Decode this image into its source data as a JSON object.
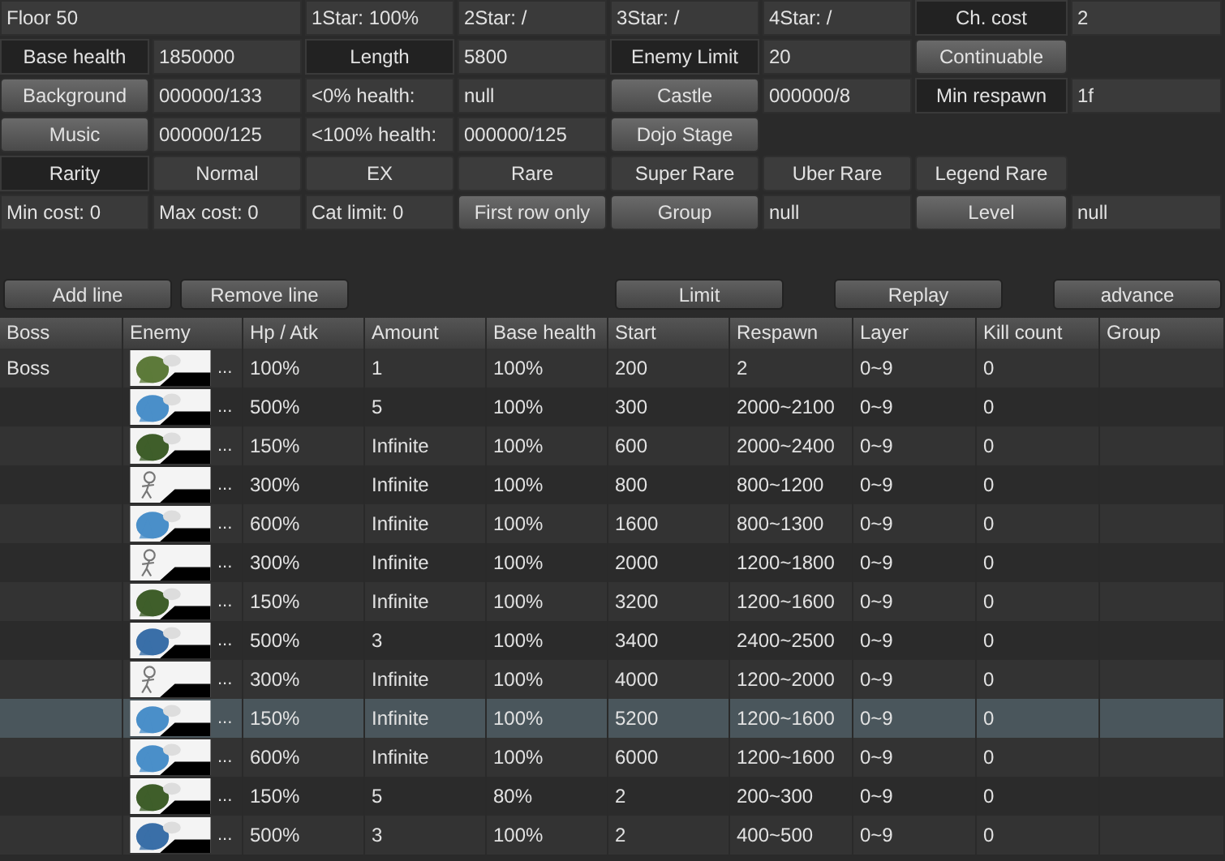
{
  "settings": [
    {
      "kind": "title",
      "text": "Floor 50"
    },
    {
      "kind": "text",
      "text": "1Star: 100%"
    },
    {
      "kind": "text",
      "text": "2Star: /"
    },
    {
      "kind": "text",
      "text": "3Star: /"
    },
    {
      "kind": "text",
      "text": "4Star: /"
    },
    {
      "kind": "label",
      "text": "Ch. cost"
    },
    {
      "kind": "text",
      "text": "2"
    },
    {
      "kind": "label",
      "text": "Base health"
    },
    {
      "kind": "text",
      "text": "1850000"
    },
    {
      "kind": "label",
      "text": "Length"
    },
    {
      "kind": "text",
      "text": "5800"
    },
    {
      "kind": "label",
      "text": "Enemy Limit"
    },
    {
      "kind": "text",
      "text": "20"
    },
    {
      "kind": "button",
      "text": "Continuable"
    },
    {
      "kind": "empty"
    },
    {
      "kind": "button",
      "text": "Background"
    },
    {
      "kind": "text",
      "text": "000000/133"
    },
    {
      "kind": "text",
      "text": "<0% health:"
    },
    {
      "kind": "text",
      "text": "null"
    },
    {
      "kind": "button",
      "text": "Castle"
    },
    {
      "kind": "text",
      "text": "000000/8"
    },
    {
      "kind": "label",
      "text": "Min respawn"
    },
    {
      "kind": "text",
      "text": "1f"
    },
    {
      "kind": "button",
      "text": "Music"
    },
    {
      "kind": "text",
      "text": "000000/125"
    },
    {
      "kind": "text",
      "text": "<100% health:"
    },
    {
      "kind": "text",
      "text": "000000/125"
    },
    {
      "kind": "button",
      "text": "Dojo Stage"
    },
    {
      "kind": "empty"
    },
    {
      "kind": "empty"
    },
    {
      "kind": "empty"
    },
    {
      "kind": "label",
      "text": "Rarity"
    },
    {
      "kind": "toggle",
      "text": "Normal"
    },
    {
      "kind": "toggle",
      "text": "EX"
    },
    {
      "kind": "toggle",
      "text": "Rare"
    },
    {
      "kind": "toggle",
      "text": "Super Rare"
    },
    {
      "kind": "toggle",
      "text": "Uber Rare"
    },
    {
      "kind": "toggle",
      "text": "Legend Rare"
    },
    {
      "kind": "empty"
    },
    {
      "kind": "text",
      "text": "Min cost: 0"
    },
    {
      "kind": "text",
      "text": "Max cost: 0"
    },
    {
      "kind": "text",
      "text": "Cat limit: 0"
    },
    {
      "kind": "button",
      "text": "First row only"
    },
    {
      "kind": "button",
      "text": "Group"
    },
    {
      "kind": "text",
      "text": "null"
    },
    {
      "kind": "button",
      "text": "Level"
    },
    {
      "kind": "text",
      "text": "null"
    }
  ],
  "actions_left": [
    "Add line",
    "Remove line"
  ],
  "actions_right": [
    "Limit",
    "Replay",
    "advance"
  ],
  "table": {
    "columns": [
      "Boss",
      "Enemy",
      "Hp / Atk",
      "Amount",
      "Base health",
      "Start",
      "Respawn",
      "Layer",
      "Kill count",
      "Group"
    ],
    "rows": [
      {
        "boss": "Boss",
        "enemy": {
          "kind": "picture",
          "more": "..."
        },
        "hp_atk": "100%",
        "amount": "1",
        "base_health": "100%",
        "start": "200",
        "respawn": "2",
        "layer": "0~9",
        "kill_count": "0",
        "selected": false
      },
      {
        "enemy": {
          "kind": "picture",
          "more": "..."
        },
        "hp_atk": "500%",
        "amount": "5",
        "base_health": "100%",
        "start": "300",
        "respawn": "2000~2100",
        "layer": "0~9",
        "kill_count": "0",
        "selected": false
      },
      {
        "enemy": {
          "kind": "picture",
          "more": "..."
        },
        "hp_atk": "150%",
        "amount": "Infinite",
        "base_health": "100%",
        "start": "600",
        "respawn": "2000~2400",
        "layer": "0~9",
        "kill_count": "0",
        "selected": false
      },
      {
        "enemy": {
          "kind": "picture",
          "more": "..."
        },
        "hp_atk": "300%",
        "amount": "Infinite",
        "base_health": "100%",
        "start": "800",
        "respawn": "800~1200",
        "layer": "0~9",
        "kill_count": "0",
        "selected": false
      },
      {
        "enemy": {
          "kind": "picture",
          "more": "..."
        },
        "hp_atk": "600%",
        "amount": "Infinite",
        "base_health": "100%",
        "start": "1600",
        "respawn": "800~1300",
        "layer": "0~9",
        "kill_count": "0",
        "selected": false
      },
      {
        "enemy": {
          "kind": "picture",
          "more": "..."
        },
        "hp_atk": "300%",
        "amount": "Infinite",
        "base_health": "100%",
        "start": "2000",
        "respawn": "1200~1800",
        "layer": "0~9",
        "kill_count": "0",
        "selected": false
      },
      {
        "enemy": {
          "kind": "picture",
          "more": "..."
        },
        "hp_atk": "150%",
        "amount": "Infinite",
        "base_health": "100%",
        "start": "3200",
        "respawn": "1200~1600",
        "layer": "0~9",
        "kill_count": "0",
        "selected": false
      },
      {
        "enemy": {
          "kind": "picture",
          "more": "..."
        },
        "hp_atk": "500%",
        "amount": "3",
        "base_health": "100%",
        "start": "3400",
        "respawn": "2400~2500",
        "layer": "0~9",
        "kill_count": "0",
        "selected": false
      },
      {
        "enemy": {
          "kind": "picture",
          "more": "..."
        },
        "hp_atk": "300%",
        "amount": "Infinite",
        "base_health": "100%",
        "start": "4000",
        "respawn": "1200~2000",
        "layer": "0~9",
        "kill_count": "0",
        "selected": false
      },
      {
        "enemy": {
          "kind": "picture",
          "more": "..."
        },
        "hp_atk": "150%",
        "amount": "Infinite",
        "base_health": "100%",
        "start": "5200",
        "respawn": "1200~1600",
        "layer": "0~9",
        "kill_count": "0",
        "selected": true
      },
      {
        "enemy": {
          "kind": "picture",
          "more": "..."
        },
        "hp_atk": "600%",
        "amount": "Infinite",
        "base_health": "100%",
        "start": "6000",
        "respawn": "1200~1600",
        "layer": "0~9",
        "kill_count": "0",
        "selected": false
      },
      {
        "enemy": {
          "kind": "picture",
          "more": "..."
        },
        "hp_atk": "150%",
        "amount": "5",
        "base_health": "80%",
        "start": "2",
        "respawn": "200~300",
        "layer": "0~9",
        "kill_count": "0",
        "selected": false
      },
      {
        "enemy": {
          "kind": "picture",
          "more": "..."
        },
        "hp_atk": "500%",
        "amount": "3",
        "base_health": "100%",
        "start": "2",
        "respawn": "400~500",
        "layer": "0~9",
        "kill_count": "0",
        "selected": false
      }
    ]
  }
}
